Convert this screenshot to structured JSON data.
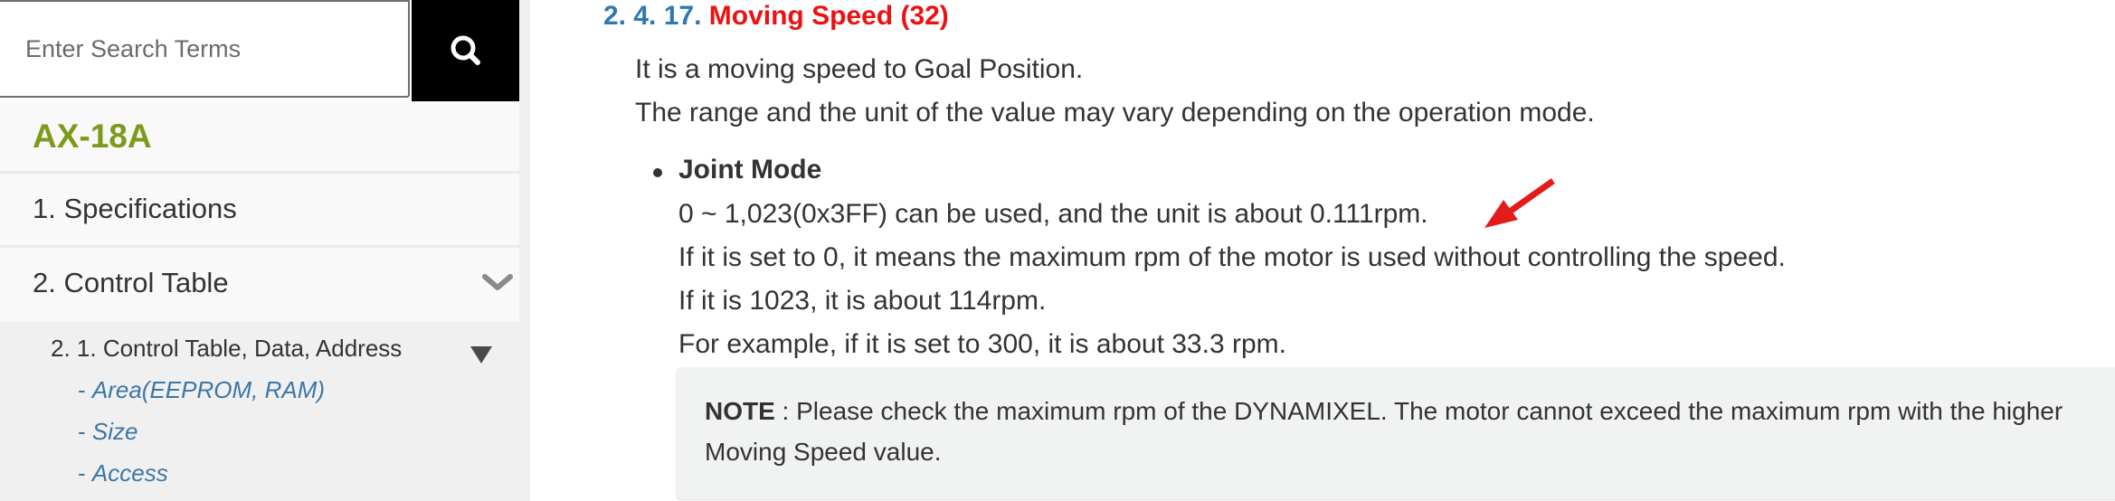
{
  "search": {
    "placeholder": "Enter Search Terms",
    "button_icon": "search-icon"
  },
  "sidebar": {
    "product_title": "AX-18A",
    "items": [
      {
        "label": "1. Specifications"
      },
      {
        "label": "2. Control Table",
        "icon": "chevron-down-icon",
        "expanded": true
      }
    ],
    "submenu": {
      "label": "2. 1. Control Table, Data, Address",
      "icon": "triangle-down-icon",
      "links": [
        {
          "dash": "- ",
          "label": "Area(EEPROM, RAM)"
        },
        {
          "dash": "- ",
          "label": "Size"
        },
        {
          "dash": "- ",
          "label": "Access"
        }
      ]
    }
  },
  "main": {
    "section_number": "2. 4. 17.",
    "section_title": "Moving Speed (32)",
    "intro": [
      "It is a moving speed to Goal Position.",
      "The range and the unit of the value may vary depending on the operation mode."
    ],
    "joint_mode": {
      "title": "Joint Mode",
      "lines": [
        "0 ~ 1,023(0x3FF) can be used, and the unit is about 0.111rpm.",
        "If it is set to 0, it means the maximum rpm of the motor is used without controlling the speed.",
        "If it is 1023, it is about 114rpm.",
        "For example, if it is set to 300, it is about 33.3 rpm."
      ]
    },
    "note": {
      "label": "NOTE",
      "line1": " : Please check the maximum rpm of the DYNAMIXEL. The motor cannot exceed the maximum rpm with the higher",
      "line2": "Moving Speed value."
    },
    "annotation": {
      "icon": "red-arrow-icon",
      "color": "#e31b1b"
    }
  },
  "colors": {
    "heading_number": "#2f78b8",
    "heading_title": "#ee1111",
    "product_title": "#7c9b1b",
    "sub_link": "#3d77a6"
  }
}
